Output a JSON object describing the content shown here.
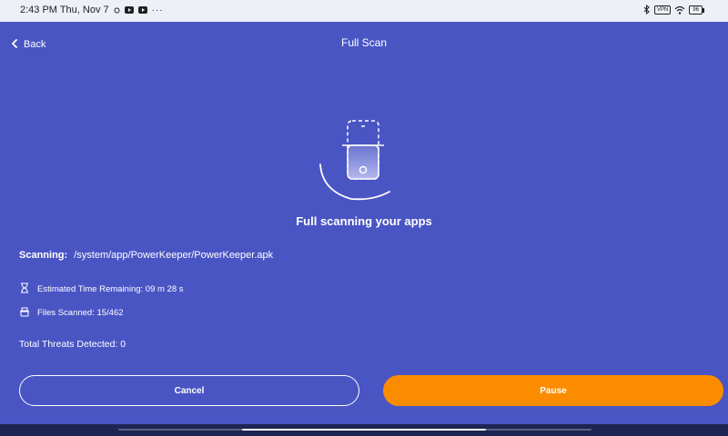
{
  "statusbar": {
    "time": "2:43 PM Thu, Nov 7",
    "more": "···",
    "vpn": "VPN",
    "battery": "96"
  },
  "header": {
    "back_label": "Back",
    "title": "Full Scan"
  },
  "main": {
    "heading": "Full scanning your apps",
    "scanning_label": "Scanning:",
    "scanning_path": "/system/app/PowerKeeper/PowerKeeper.apk",
    "time_remaining": "Estimated Time Remaining: 09 m 28 s",
    "files_scanned": "Files Scanned: 15/462",
    "threats": "Total Threats Detected: 0"
  },
  "actions": {
    "cancel_label": "Cancel",
    "pause_label": "Pause"
  },
  "colors": {
    "background": "#4a55c4",
    "pause_button": "#fb8c00"
  },
  "icons": [
    "back-chevron-icon",
    "hourglass-icon",
    "files-icon",
    "phone-scan-icon",
    "bluetooth-icon",
    "wifi-icon",
    "battery-icon",
    "youtube-icon"
  ]
}
